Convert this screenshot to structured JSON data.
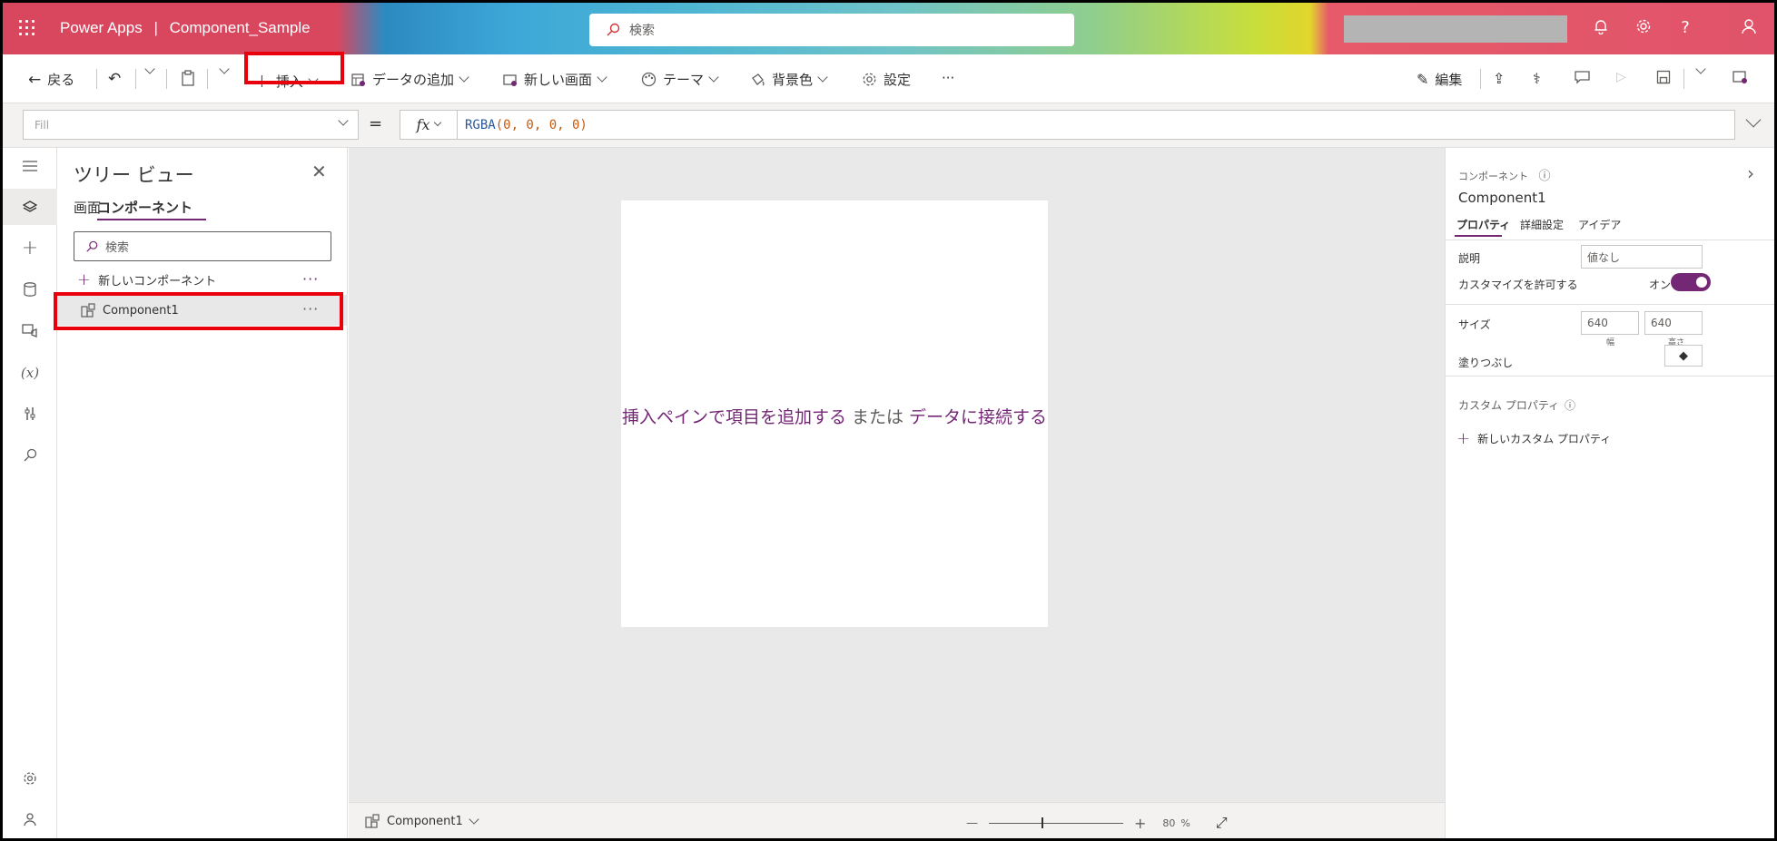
{
  "header": {
    "app_name": "Power Apps",
    "separator": "|",
    "app_title": "Component_Sample",
    "search_placeholder": "検索"
  },
  "toolbar": {
    "back_label": "戻る",
    "insert_label": "挿入",
    "add_data_label": "データの追加",
    "new_screen_label": "新しい画面",
    "theme_label": "テーマ",
    "background_label": "背景色",
    "settings_label": "設定",
    "more_label": "···",
    "edit_label": "編集"
  },
  "formula_bar": {
    "property": "Fill",
    "equals": "=",
    "fx_label": "fx",
    "func": "RGBA",
    "args": "(0, 0, 0, 0)"
  },
  "tree_view": {
    "title": "ツリー ビュー",
    "tabs": [
      "画面",
      "コンポーネント"
    ],
    "search_placeholder": "検索",
    "new_component_label": "新しいコンポーネント",
    "items": [
      {
        "label": "Component1"
      }
    ]
  },
  "canvas": {
    "hint_part1": "挿入ペインで項目を追加する",
    "hint_part2": " または ",
    "hint_part3": "データに接続する",
    "bottom_component": "Component1",
    "zoom_minus": "—",
    "zoom_plus": "+",
    "zoom_value": "80",
    "zoom_unit": "%"
  },
  "properties_panel": {
    "section_label": "コンポーネント",
    "component_name": "Component1",
    "tabs": [
      "プロパティ",
      "詳細設定",
      "アイデア"
    ],
    "description_label": "説明",
    "description_placeholder": "値なし",
    "customizable_label": "カスタマイズを許可する",
    "customizable_value": "オン",
    "size_label": "サイズ",
    "width_value": "640",
    "height_value": "640",
    "width_caption": "幅",
    "height_caption": "高さ",
    "fill_label": "塗りつぶし",
    "custom_props_label": "カスタム プロパティ",
    "new_custom_prop_label": "新しいカスタム プロパティ"
  },
  "colors": {
    "accent": "#742774",
    "header_red": "#d9475f",
    "highlight_red": "#e8000d"
  }
}
